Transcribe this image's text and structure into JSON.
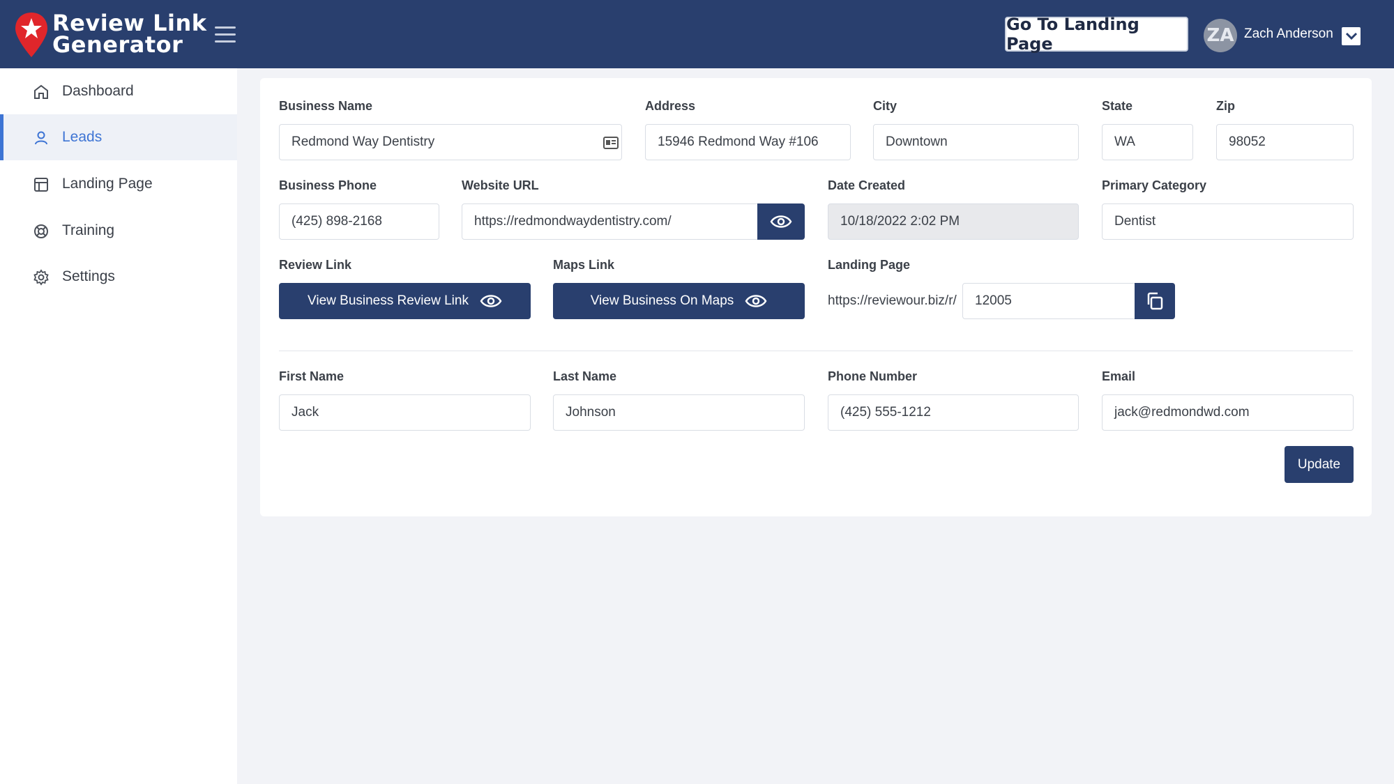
{
  "header": {
    "logo_line1": "Review Link",
    "logo_line2": "Generator",
    "go_landing_label": "Go To Landing Page",
    "avatar_initials": "ZA",
    "user_name": "Zach Anderson"
  },
  "sidebar": {
    "items": [
      {
        "label": "Dashboard",
        "icon": "home-icon"
      },
      {
        "label": "Leads",
        "icon": "user-icon",
        "active": true
      },
      {
        "label": "Landing Page",
        "icon": "layout-icon"
      },
      {
        "label": "Training",
        "icon": "lifebuoy-icon"
      },
      {
        "label": "Settings",
        "icon": "gear-icon"
      }
    ]
  },
  "form": {
    "business_name": {
      "label": "Business Name",
      "value": "Redmond Way Dentistry"
    },
    "address": {
      "label": "Address",
      "value": "15946 Redmond Way #106"
    },
    "city": {
      "label": "City",
      "value": "Downtown"
    },
    "state": {
      "label": "State",
      "value": "WA"
    },
    "zip": {
      "label": "Zip",
      "value": "98052"
    },
    "business_phone": {
      "label": "Business Phone",
      "value": "(425) 898-2168"
    },
    "website_url": {
      "label": "Website URL",
      "value": "https://redmondwaydentistry.com/"
    },
    "date_created": {
      "label": "Date Created",
      "value": "10/18/2022 2:02 PM"
    },
    "primary_category": {
      "label": "Primary Category",
      "value": "Dentist"
    },
    "review_link": {
      "label": "Review Link",
      "button": "View Business Review Link"
    },
    "maps_link": {
      "label": "Maps Link",
      "button": "View Business On Maps"
    },
    "landing_page": {
      "label": "Landing Page",
      "prefix": "https://reviewour.biz/r/",
      "value": "12005"
    },
    "first_name": {
      "label": "First Name",
      "value": "Jack"
    },
    "last_name": {
      "label": "Last Name",
      "value": "Johnson"
    },
    "phone_number": {
      "label": "Phone Number",
      "value": "(425) 555-1212"
    },
    "email": {
      "label": "Email",
      "value": "jack@redmondwd.com"
    },
    "update_label": "Update"
  },
  "colors": {
    "header_bg": "#293f6e",
    "accent": "#3d74d4",
    "logo_red": "#e0262b"
  }
}
